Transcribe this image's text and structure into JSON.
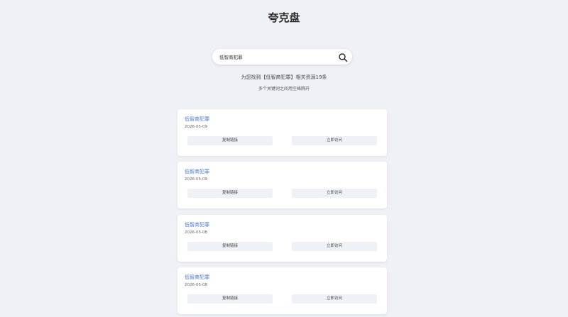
{
  "header": {
    "title": "夸克盘"
  },
  "search": {
    "value": "低智商犯罪",
    "icon": "search-icon"
  },
  "results": {
    "summary": "为您找到【低智商犯罪】相关资源19条",
    "tip": "多个关键词之间用空格隔开",
    "items": [
      {
        "title": "低智商犯罪",
        "date": "2026-05-09",
        "copy_label": "复制链接",
        "visit_label": "立即访问"
      },
      {
        "title": "低智商犯罪",
        "date": "2026-05-09",
        "copy_label": "复制链接",
        "visit_label": "立即访问"
      },
      {
        "title": "低智商犯罪",
        "date": "2026-05-08",
        "copy_label": "复制链接",
        "visit_label": "立即访问"
      },
      {
        "title": "低智商犯罪",
        "date": "2026-05-08",
        "copy_label": "复制链接",
        "visit_label": "立即访问"
      }
    ]
  },
  "colors": {
    "background": "#eef1f5",
    "link": "#4a7bd0",
    "button": "#eef1f6"
  }
}
